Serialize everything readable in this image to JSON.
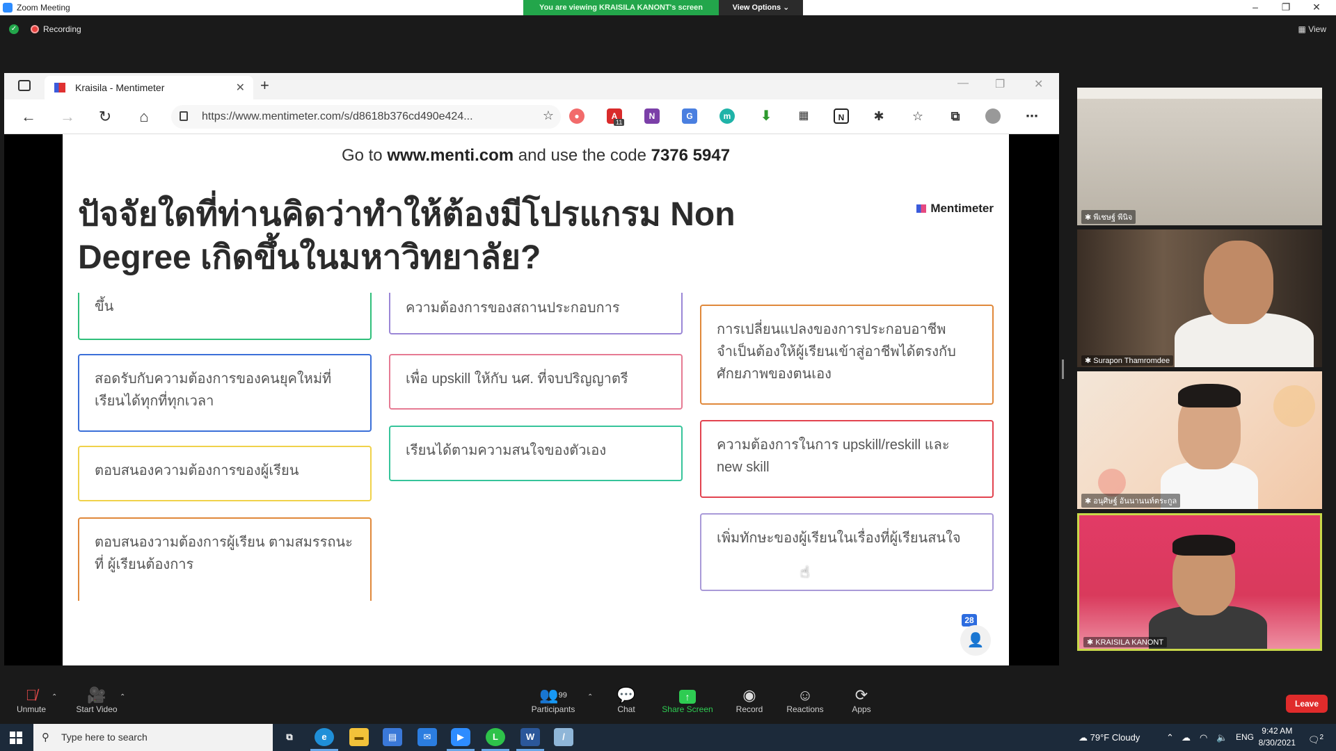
{
  "zoom": {
    "window_title": "Zoom Meeting",
    "share_banner": "You are viewing KRAISILA KANONT's screen",
    "view_options": "View Options ⌄",
    "recording": "Recording",
    "view": "View"
  },
  "browser": {
    "tab_title": "Kraisila - Mentimeter",
    "url": "https://www.mentimeter.com/s/d8618b376cd490e424...",
    "ext_badge": "11"
  },
  "slide": {
    "goto_prefix": "Go to ",
    "goto_site": "www.menti.com",
    "goto_mid": " and use the code ",
    "goto_code": "7376 5947",
    "question": "ปัจจัยใดที่ท่านคิดว่าทำให้ต้องมีโปรแกรม Non Degree เกิดขึ้นในมหาวิทยาลัย?",
    "logo": "Mentimeter",
    "participant_count": "28",
    "responses": [
      {
        "text": "ขึ้น",
        "color": "#2fbf7a"
      },
      {
        "text": "สอดรับกับความต้องการของคนยุคใหม่ที่เรียนได้ทุกที่ทุกเวลา",
        "color": "#3b6fd8"
      },
      {
        "text": "ตอบสนองความต้องการของผู้เรียน",
        "color": "#f0d24a"
      },
      {
        "text": "ตอบสนองวามต้องการผู้เรียน ตามสมรรถนะที่ ผู้เรียนต้องการ",
        "color": "#e0883a"
      },
      {
        "text": "ความต้องการของสถานประกอบการ",
        "color": "#9a86d6"
      },
      {
        "text": "เพื่อ upskill ให้กับ นศ. ที่จบปริญญาตรี",
        "color": "#e67a93"
      },
      {
        "text": "เรียนได้ตามความสนใจของตัวเอง",
        "color": "#36c49a"
      },
      {
        "text": "การเปลี่ยนแปลงของการประกอบอาชีพจำเป็นต้องให้ผู้เรียนเข้าสู่อาชีพได้ตรงกับศักยภาพของตนเอง",
        "color": "#e0883a"
      },
      {
        "text": "ความต้องการในการ upskill/reskill และ new skill",
        "color": "#e2434f"
      },
      {
        "text": "เพิ่มทักษะของผู้เรียนในเรื่องที่ผู้เรียนสนใจ",
        "color": "#a99ad8"
      }
    ]
  },
  "videos": [
    {
      "name": "พีเชษฐ์ พีนิจ"
    },
    {
      "name": "Surapon Thamromdee"
    },
    {
      "name": "อนุศิษฐ์ อันนานนท์ตระกูล"
    },
    {
      "name": "KRAISILA KANONT"
    }
  ],
  "toolbar": {
    "unmute": "Unmute",
    "start_video": "Start Video",
    "participants": "Participants",
    "participants_count": "99",
    "chat": "Chat",
    "share_screen": "Share Screen",
    "record": "Record",
    "reactions": "Reactions",
    "apps": "Apps",
    "leave": "Leave"
  },
  "taskbar": {
    "search_placeholder": "Type here to search",
    "weather": "79°F  Cloudy",
    "lang": "ENG",
    "time": "9:42 AM",
    "date": "8/30/2021",
    "notif_count": "2"
  }
}
